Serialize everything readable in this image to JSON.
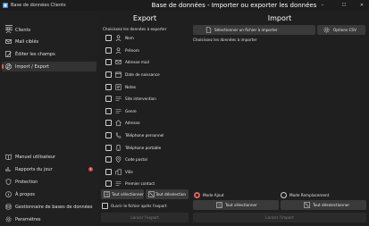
{
  "window": {
    "title": "Base de données Clients"
  },
  "window_controls": {
    "minimize": "–",
    "maximize": "☐",
    "close": "✕"
  },
  "sidebar": {
    "top_items": [
      {
        "label": "Clients",
        "icon": "person-icon"
      },
      {
        "label": "Mail ciblés",
        "icon": "mail-icon"
      },
      {
        "label": "Éditer les champs",
        "icon": "edit-icon"
      },
      {
        "label": "Import / Export",
        "icon": "import-export-icon",
        "active": true
      }
    ],
    "bottom_items": [
      {
        "label": "Manuel utilisateur",
        "icon": "book-icon"
      },
      {
        "label": "Rapports du jour",
        "icon": "chart-icon",
        "badge": "1"
      },
      {
        "label": "Protection",
        "icon": "shield-icon"
      },
      {
        "label": "À propos",
        "icon": "info-icon"
      },
      {
        "label": "Gestionnaire de bases de données",
        "icon": "database-icon"
      },
      {
        "label": "Paramètres",
        "icon": "gear-icon"
      }
    ]
  },
  "header": {
    "title": "Base de données - Importer ou exporter les données"
  },
  "export": {
    "title": "Export",
    "instruction": "Choisissez les données à exporter",
    "fields": [
      {
        "label": "Nom",
        "icon": "person-icon"
      },
      {
        "label": "Prénom",
        "icon": "person-icon"
      },
      {
        "label": "Adresse mail",
        "icon": "mail-icon"
      },
      {
        "label": "Date de naissance",
        "icon": "calendar-icon"
      },
      {
        "label": "Notes",
        "icon": "note-icon"
      },
      {
        "label": "Site intervention",
        "icon": "list-icon"
      },
      {
        "label": "Genre",
        "icon": "list-icon"
      },
      {
        "label": "Adresse",
        "icon": "home-icon"
      },
      {
        "label": "Téléphone personnel",
        "icon": "phone-icon"
      },
      {
        "label": "Téléphone portable",
        "icon": "phone-icon"
      },
      {
        "label": "Code postal",
        "icon": "location-icon"
      },
      {
        "label": "Ville",
        "icon": "city-icon"
      },
      {
        "label": "Premier contact",
        "icon": "list-icon"
      }
    ],
    "select_all": "Tout sélectionner",
    "deselect_all": "Tout déselection",
    "open_after": "Ouvrir le fichier après l'export",
    "run": "Lancer l'export"
  },
  "import": {
    "title": "Import",
    "select_file": "Sélectionner un fichier à importer",
    "options": "Options CSV",
    "instruction": "Choisissez les données à importer",
    "mode_add": "Mode Ajout",
    "mode_replace": "Mode Remplacement",
    "select_all": "Tout sélectionner",
    "deselect_all": "Tout déselectionner",
    "run": "Lancer l'import"
  },
  "colors": {
    "accent": "#e06060",
    "background": "#1f1f1f",
    "sidebar": "#202020",
    "button": "#3a3a3a"
  }
}
